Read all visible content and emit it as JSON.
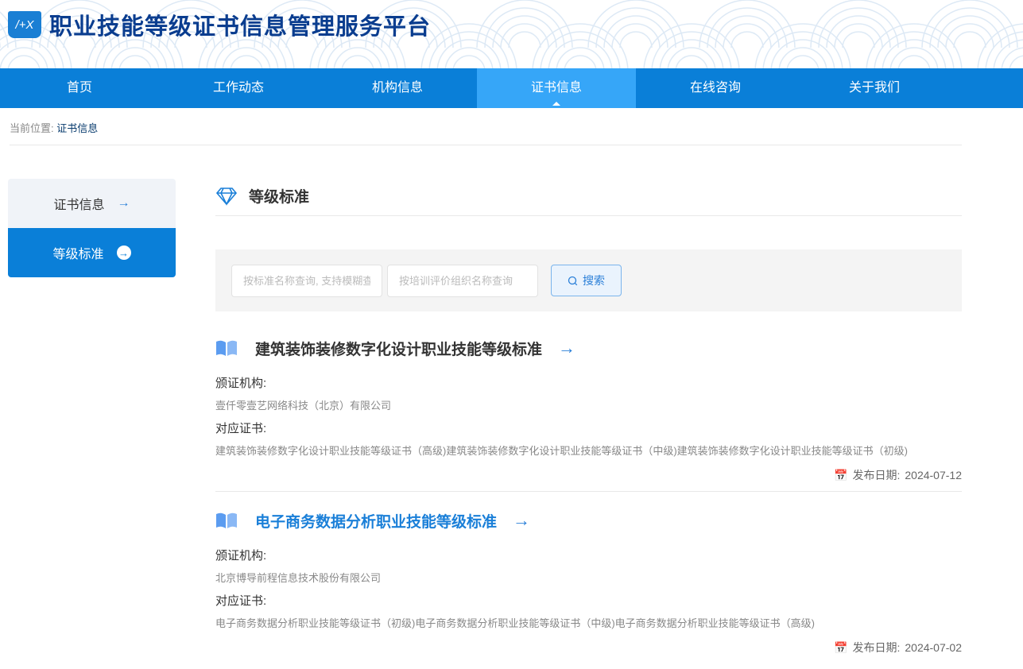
{
  "header": {
    "logo_text": "/+X",
    "title": "职业技能等级证书信息管理服务平台"
  },
  "nav": [
    {
      "label": "首页"
    },
    {
      "label": "工作动态"
    },
    {
      "label": "机构信息"
    },
    {
      "label": "证书信息"
    },
    {
      "label": "在线咨询"
    },
    {
      "label": "关于我们"
    }
  ],
  "nav_active": 3,
  "breadcrumb": {
    "prefix": "当前位置:",
    "current": "证书信息"
  },
  "sidebar": {
    "items": [
      {
        "label": "证书信息"
      },
      {
        "label": "等级标准"
      }
    ]
  },
  "section": {
    "title": "等级标准"
  },
  "search": {
    "name_placeholder": "按标准名称查询, 支持模糊查询",
    "org_placeholder": "按培训评价组织名称查询",
    "button": "搜索"
  },
  "labels": {
    "org": "颁证机构:",
    "cert": "对应证书:",
    "date": "发布日期:"
  },
  "items": [
    {
      "title": "建筑装饰装修数字化设计职业技能等级标准",
      "org": "壹仟零壹艺网络科技（北京）有限公司",
      "certs": "建筑装饰装修数字化设计职业技能等级证书（高级)建筑装饰装修数字化设计职业技能等级证书（中级)建筑装饰装修数字化设计职业技能等级证书（初级)",
      "date": "2024-07-12"
    },
    {
      "title": "电子商务数据分析职业技能等级标准",
      "org": "北京博导前程信息技术股份有限公司",
      "certs": "电子商务数据分析职业技能等级证书（初级)电子商务数据分析职业技能等级证书（中级)电子商务数据分析职业技能等级证书（高级)",
      "date": "2024-07-02"
    }
  ],
  "colors": {
    "primary": "#0a7fd8",
    "nav_active": "#36a6f8",
    "title": "#0a3d8f"
  }
}
